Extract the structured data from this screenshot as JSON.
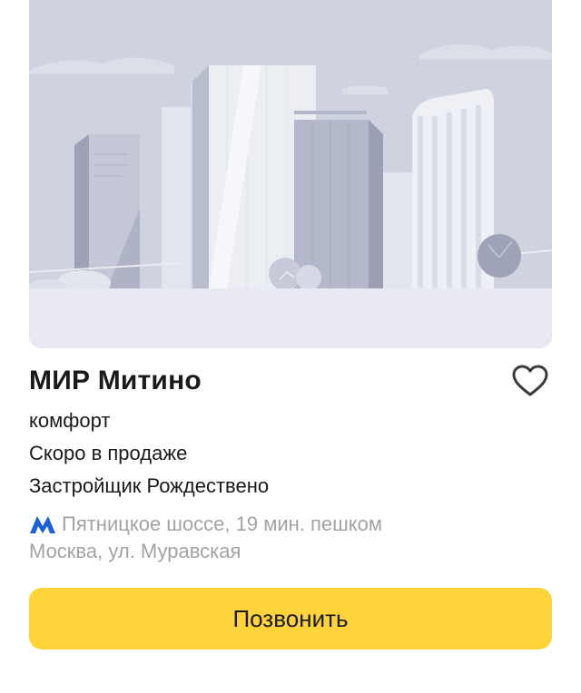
{
  "card": {
    "title": "МИР Митино",
    "class": "комфорт",
    "status": "Скоро в продаже",
    "developer": "Застройщик Рождествено",
    "metro": {
      "icon": "metro-m-icon",
      "text": "Пятницкое шоссе, 19 мин. пешком"
    },
    "address": "Москва, ул. Муравская",
    "favorite_icon": "heart-outline-icon",
    "call_label": "Позвонить"
  },
  "colors": {
    "accent_button": "#ffd43b",
    "secondary_text": "#a3a3a3",
    "metro_icon": "#1b5fd9",
    "illustration_bg": "#cdd1de"
  }
}
